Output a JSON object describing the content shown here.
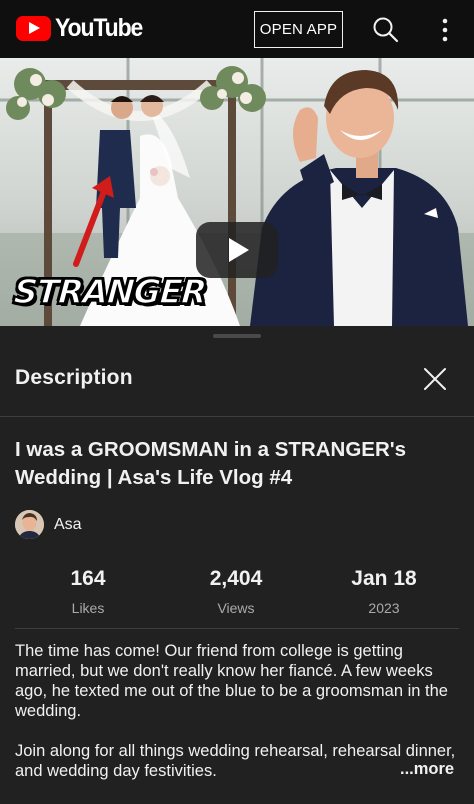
{
  "header": {
    "brand": "YouTube",
    "open_app_label": "OPEN APP",
    "icons": [
      "youtube-logo-icon",
      "search-icon",
      "more-vert-icon"
    ]
  },
  "player": {
    "thumbnail_caption": "STRANGER"
  },
  "description_sheet": {
    "title": "Description",
    "close_icon": "close-icon",
    "video_title": "I was a GROOMSMAN in a STRANGER's Wedding | Asa's Life Vlog #4",
    "channel_name": "Asa",
    "stats": {
      "likes_value": "164",
      "likes_label": "Likes",
      "views_value": "2,404",
      "views_label": "Views",
      "date_value": "Jan 18",
      "date_year": "2023"
    },
    "description_paragraph_1": "The time has come! Our friend from college is getting married, but we don't really know her fiancé. A few weeks ago, he texted me out of the blue to be a groomsman in the wedding.",
    "description_paragraph_2": "Join along for all things wedding rehearsal, rehearsal dinner, and wedding day festivities.",
    "more_label": "...more"
  },
  "colors": {
    "brand_red": "#ff0000",
    "background": "#0f0f0f",
    "sheet_background": "#212121",
    "secondary_text": "#aaaaaa"
  }
}
